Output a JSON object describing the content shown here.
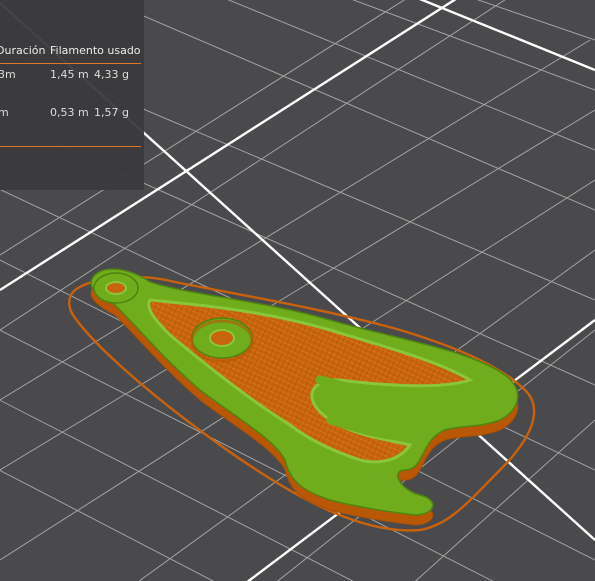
{
  "stats_table": {
    "headers": {
      "duration": "Duración",
      "filament": "Filamento usado"
    },
    "rows": [
      {
        "duration": "3m",
        "length": "1,45 m",
        "weight": "4,33 g"
      },
      {
        "duration": "m",
        "length": "0,53 m",
        "weight": "1,57 g"
      }
    ]
  },
  "colors": {
    "background": "#4a4a4c",
    "panel": "#3a3a3c",
    "panel_rule": "#d97a2b",
    "grid_line": "#bdbdbd",
    "main_grid_line": "#ffffff",
    "extrusion_orange": "#d06a10",
    "extrusion_green": "#6fad1c",
    "skirt": "#c8620d"
  },
  "viewport": {
    "object": "rocket-keychain-print-preview"
  }
}
